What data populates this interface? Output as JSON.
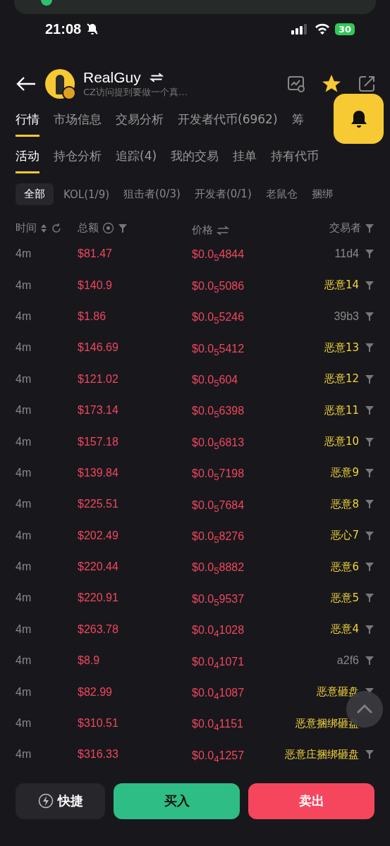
{
  "status_bar": {
    "time": "21:08",
    "battery": "30"
  },
  "header": {
    "title": "RealGuy",
    "subtitle": "CZ访问提到要做一个真…",
    "favorited": true
  },
  "tabs": [
    {
      "label": "行情",
      "selected": true
    },
    {
      "label": "市场信息",
      "selected": false
    },
    {
      "label": "交易分析",
      "selected": false
    },
    {
      "label": "开发者代币(6962)",
      "selected": false
    },
    {
      "label": "筹",
      "selected": false
    }
  ],
  "subtabs": [
    {
      "label": "活动",
      "selected": true
    },
    {
      "label": "持仓分析",
      "selected": false
    },
    {
      "label": "追踪(4)",
      "selected": false
    },
    {
      "label": "我的交易",
      "selected": false
    },
    {
      "label": "挂单",
      "selected": false
    },
    {
      "label": "持有代币",
      "selected": false
    }
  ],
  "filters": [
    {
      "label": "全部",
      "selected": true
    },
    {
      "label": "KOL(1/9)",
      "selected": false
    },
    {
      "label": "狙击者(0/3)",
      "selected": false
    },
    {
      "label": "开发者(0/1)",
      "selected": false
    },
    {
      "label": "老鼠仓",
      "selected": false
    },
    {
      "label": "捆绑",
      "selected": false
    }
  ],
  "table": {
    "columns": [
      "时间",
      "总额",
      "价格",
      "交易者"
    ],
    "rows": [
      {
        "time": "4m",
        "amount": "$81.47",
        "price": "$0.0$_{5}$4844",
        "trader": "11d4",
        "kind": "address",
        "filter_shown": true
      },
      {
        "time": "4m",
        "amount": "$140.9",
        "price": "$0.0$_{5}$5086",
        "trader": "恶意14",
        "kind": "tagged",
        "filter_shown": true
      },
      {
        "time": "4m",
        "amount": "$1.86",
        "price": "$0.0$_{5}$5246",
        "trader": "39b3",
        "kind": "address",
        "filter_shown": true
      },
      {
        "time": "4m",
        "amount": "$146.69",
        "price": "$0.0$_{5}$5412",
        "trader": "恶意13",
        "kind": "tagged",
        "filter_shown": true
      },
      {
        "time": "4m",
        "amount": "$121.02",
        "price": "$0.0$_{5}$604",
        "trader": "恶意12",
        "kind": "tagged",
        "filter_shown": true
      },
      {
        "time": "4m",
        "amount": "$173.14",
        "price": "$0.0$_{5}$6398",
        "trader": "恶意11",
        "kind": "tagged",
        "filter_shown": true
      },
      {
        "time": "4m",
        "amount": "$157.18",
        "price": "$0.0$_{5}$6813",
        "trader": "恶意10",
        "kind": "tagged",
        "filter_shown": true
      },
      {
        "time": "4m",
        "amount": "$139.84",
        "price": "$0.0$_{5}$7198",
        "trader": "恶意9",
        "kind": "tagged",
        "filter_shown": true
      },
      {
        "time": "4m",
        "amount": "$225.51",
        "price": "$0.0$_{5}$7684",
        "trader": "恶意8",
        "kind": "tagged",
        "filter_shown": true
      },
      {
        "time": "4m",
        "amount": "$202.49",
        "price": "$0.0$_{5}$8276",
        "trader": "恶心7",
        "kind": "tagged",
        "filter_shown": true
      },
      {
        "time": "4m",
        "amount": "$220.44",
        "price": "$0.0$_{5}$8882",
        "trader": "恶意6",
        "kind": "tagged",
        "filter_shown": true
      },
      {
        "time": "4m",
        "amount": "$220.91",
        "price": "$0.0$_{5}$9537",
        "trader": "恶意5",
        "kind": "tagged",
        "filter_shown": true
      },
      {
        "time": "4m",
        "amount": "$263.78",
        "price": "$0.0$_{4}$1028",
        "trader": "恶意4",
        "kind": "tagged",
        "filter_shown": true
      },
      {
        "time": "4m",
        "amount": "$8.9",
        "price": "$0.0$_{4}$1071",
        "trader": "a2f6",
        "kind": "address",
        "filter_shown": true
      },
      {
        "time": "4m",
        "amount": "$82.99",
        "price": "$0.0$_{4}$1087",
        "trader": "恶意砸盘",
        "kind": "tagged",
        "filter_shown": true
      },
      {
        "time": "4m",
        "amount": "$310.51",
        "price": "$0.0$_{4}$1151",
        "trader": "恶意捆绑砸盘",
        "kind": "tagged",
        "filter_shown": false
      },
      {
        "time": "4m",
        "amount": "$316.33",
        "price": "$0.0$_{4}$1257",
        "trader": "恶意庄捆绑砸盘",
        "kind": "tagged",
        "filter_shown": true
      }
    ]
  },
  "actions": [
    {
      "label": "快捷",
      "kind": "quick"
    },
    {
      "label": "买入",
      "kind": "buy"
    },
    {
      "label": "卖出",
      "kind": "sell"
    }
  ]
}
